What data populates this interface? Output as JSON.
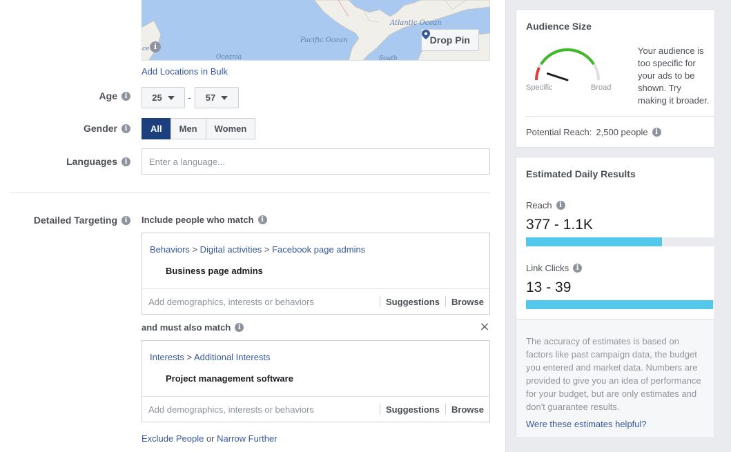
{
  "map": {
    "ocean_labels": [
      "Atlantic Ocean",
      "Pacific Ocean",
      "Oceania",
      "South",
      "ce"
    ],
    "info_icon": "info-icon",
    "drop_pin_label": "Drop Pin",
    "drop_pin_icon": "map-pin-icon"
  },
  "locations": {
    "bulk_link": "Add Locations in Bulk"
  },
  "age": {
    "label": "Age",
    "min": "25",
    "max": "57",
    "dash": "-"
  },
  "gender": {
    "label": "Gender",
    "options": [
      "All",
      "Men",
      "Women"
    ],
    "selected": "All"
  },
  "languages": {
    "label": "Languages",
    "placeholder": "Enter a language..."
  },
  "detailed_targeting": {
    "label": "Detailed Targeting",
    "include_heading": "Include people who match",
    "include_box": {
      "crumbs": [
        "Behaviors",
        "Digital activities",
        "Facebook page admins"
      ],
      "separator": " > ",
      "item": "Business page admins",
      "placeholder": "Add demographics, interests or behaviors",
      "suggestions": "Suggestions",
      "browse": "Browse"
    },
    "narrow_heading": "and must also match",
    "narrow_box": {
      "crumbs": [
        "Interests",
        "Additional Interests"
      ],
      "separator": " > ",
      "item": "Project management software",
      "placeholder": "Add demographics, interests or behaviors",
      "suggestions": "Suggestions",
      "browse": "Browse"
    },
    "close_glyph": "×",
    "exclude_link": "Exclude People",
    "or_text": " or ",
    "narrow_link": "Narrow Further"
  },
  "audience_size": {
    "title": "Audience Size",
    "gauge_low": "Specific",
    "gauge_high": "Broad",
    "gauge_level": 0.1,
    "message": "Your audience is too specific for your ads to be shown. Try making it broader.",
    "potential_reach_label": "Potential Reach:",
    "potential_reach_value": "2,500 people"
  },
  "estimated": {
    "title": "Estimated Daily Results",
    "reach_label": "Reach",
    "reach_value": "377 - 1.1K",
    "reach_fill": 0.72,
    "clicks_label": "Link Clicks",
    "clicks_value": "13 - 39",
    "clicks_fill": 0.99,
    "note": "The accuracy of estimates is based on factors like past campaign data, the budget you entered and market data. Numbers are provided to give you an idea of performance for your budget, but are only estimates and don't guarantee results.",
    "helpful_link": "Were these estimates helpful?"
  },
  "colors": {
    "brand_blue": "#365899",
    "selected_blue": "#1d3f7d",
    "bar_fill": "#54c7ec",
    "gauge_green": "#42b72a",
    "gauge_red": "#e03d3d"
  }
}
